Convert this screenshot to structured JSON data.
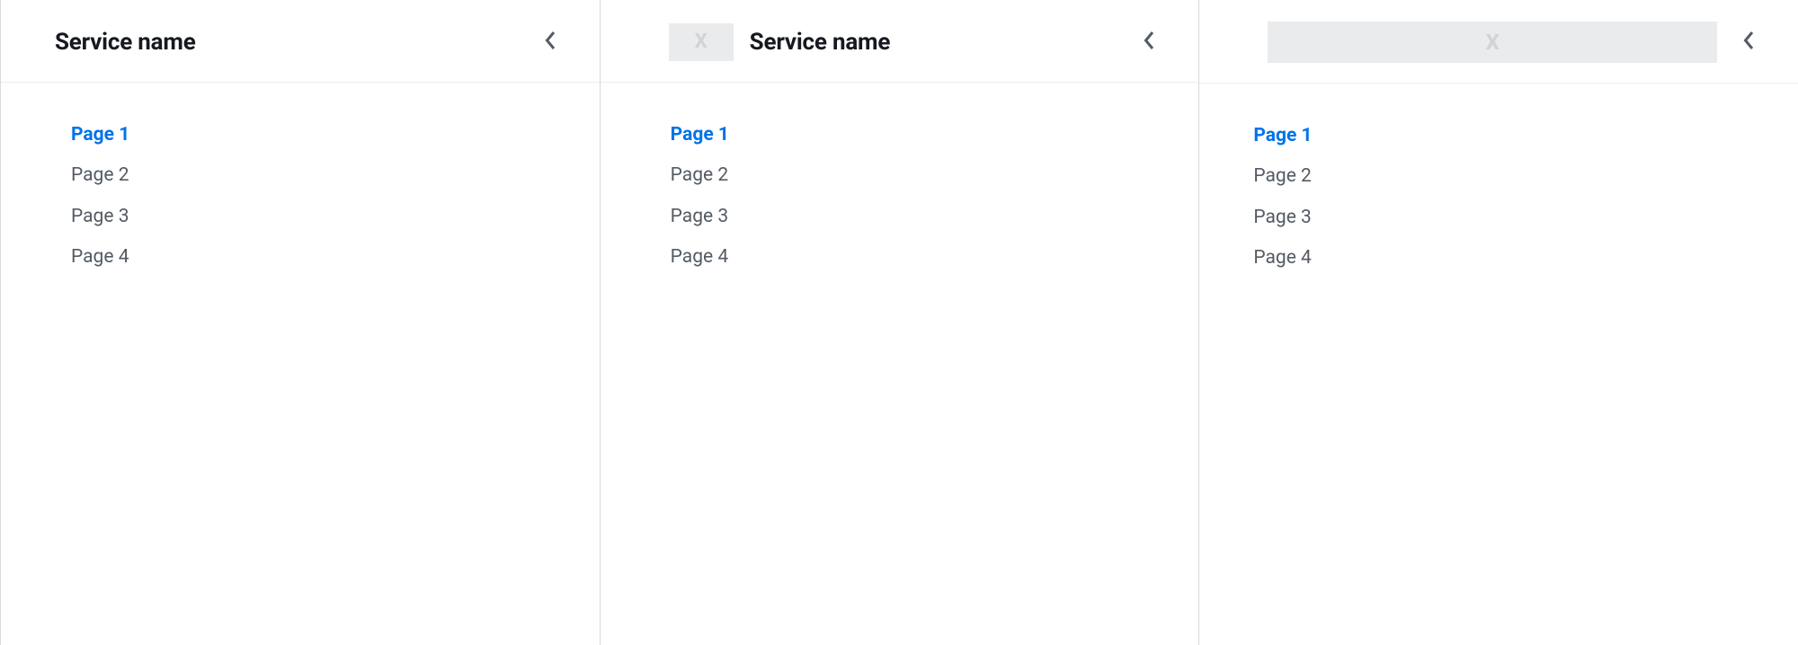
{
  "panels": [
    {
      "variant": "title-only",
      "title": "Service name",
      "logo_text": "",
      "pages": [
        {
          "label": "Page 1",
          "active": true
        },
        {
          "label": "Page 2",
          "active": false
        },
        {
          "label": "Page 3",
          "active": false
        },
        {
          "label": "Page 4",
          "active": false
        }
      ]
    },
    {
      "variant": "logo-and-title",
      "title": "Service name",
      "logo_text": "X",
      "pages": [
        {
          "label": "Page 1",
          "active": true
        },
        {
          "label": "Page 2",
          "active": false
        },
        {
          "label": "Page 3",
          "active": false
        },
        {
          "label": "Page 4",
          "active": false
        }
      ]
    },
    {
      "variant": "logo-only",
      "title": "",
      "logo_text": "X",
      "pages": [
        {
          "label": "Page 1",
          "active": true
        },
        {
          "label": "Page 2",
          "active": false
        },
        {
          "label": "Page 3",
          "active": false
        },
        {
          "label": "Page 4",
          "active": false
        }
      ]
    }
  ]
}
